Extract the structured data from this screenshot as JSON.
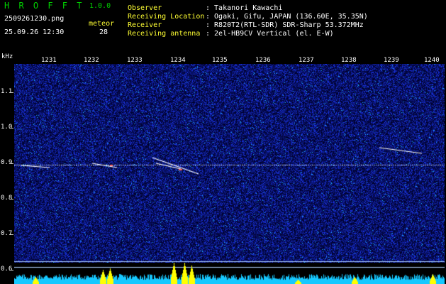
{
  "header": {
    "app_name": "H R O F F T",
    "version": "1.0.0",
    "filename": "2509261230.png",
    "datetime": "25.09.26 12:30",
    "meteor_label": "meteor",
    "meteor_count": "28",
    "info": [
      {
        "label": "Observer",
        "value": ": Takanori Kawachi"
      },
      {
        "label": "Receiving Location",
        "value": ": Ogaki, Gifu, JAPAN (136.60E, 35.35N)"
      },
      {
        "label": "Receiver",
        "value": ": R820T2(RTL-SDR) SDR-Sharp 53.372MHz"
      },
      {
        "label": "Receiving antenna",
        "value": ": 2el-HB9CV Vertical (el. E-W)"
      }
    ]
  },
  "axes": {
    "y_unit": "kHz",
    "x_ticks": [
      "1231",
      "1232",
      "1233",
      "1234",
      "1235",
      "1236",
      "1237",
      "1238",
      "1239",
      "1240"
    ],
    "y_ticks": [
      "1.1",
      "1.0",
      "0.9",
      "0.8",
      "0.7",
      "0.6"
    ]
  },
  "colors": {
    "background": "#000000",
    "noise_low": "#00104a",
    "noise_high": "#1a3cff",
    "carrier": "#e0f0ff",
    "meteor_trace": "#ffffff",
    "histogram_cyan": "#16c8ff",
    "histogram_yellow": "#ffff00",
    "label_yellow": "#ffff33",
    "label_green": "#00d000"
  }
}
